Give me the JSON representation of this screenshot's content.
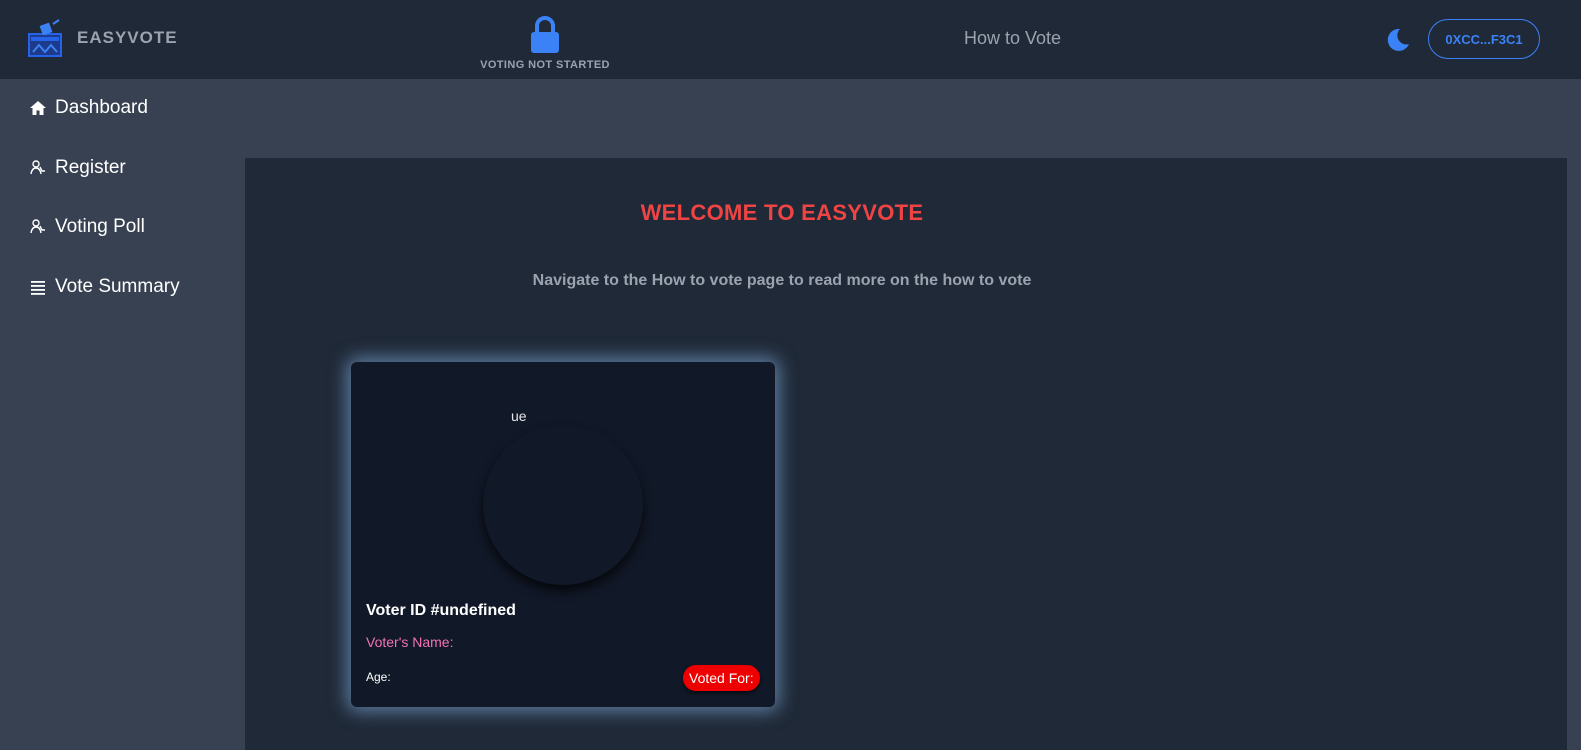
{
  "header": {
    "brand": "EASYVOTE",
    "brand_icon": "ballot-box-icon",
    "status_icon": "lock-icon",
    "status_text": "VOTING NOT STARTED",
    "how_to_vote": "How to Vote",
    "theme_icon": "moon-icon",
    "wallet": "0XCC...F3C1",
    "accent_color": "#3b82f6"
  },
  "sidebar": {
    "items": [
      {
        "label": "Dashboard",
        "icon": "home-icon"
      },
      {
        "label": "Register",
        "icon": "users-icon"
      },
      {
        "label": "Voting Poll",
        "icon": "users-icon"
      },
      {
        "label": "Vote Summary",
        "icon": "list-icon"
      }
    ]
  },
  "main": {
    "title": "WELCOME TO EASYVOTE",
    "title_color": "#ef4444",
    "subtitle": "Navigate to the How to vote page to read more on the how to vote",
    "card": {
      "avatar_alt": "ue",
      "voter_id": "Voter ID #undefined",
      "voter_name": "Voter's Name:",
      "age": "Age:",
      "voted_for": "Voted For:",
      "badge_color": "#ef0000"
    }
  }
}
